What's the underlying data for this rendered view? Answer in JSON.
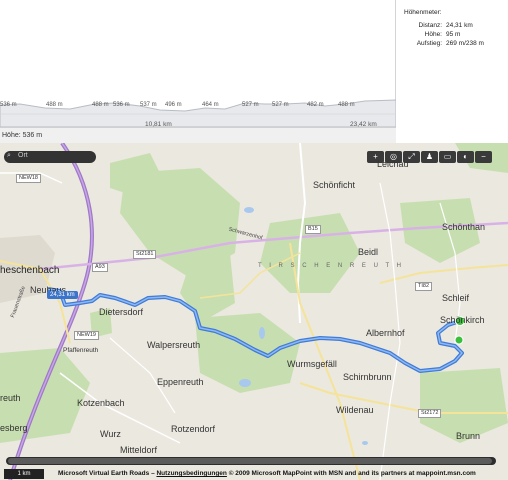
{
  "profile": {
    "tick_labels": [
      "536 m",
      "488 m",
      "488 m",
      "536 m",
      "537 m",
      "496 m",
      "464 m",
      "527 m",
      "527 m",
      "482 m",
      "488 m"
    ],
    "km_marks": [
      "10,81 km",
      "23,42 km"
    ],
    "height_readout": "Höhe: 536 m"
  },
  "stats": {
    "title": "Höhenmeter:",
    "rows": [
      {
        "key": "Distanz:",
        "value": "24,31 km"
      },
      {
        "key": "Höhe:",
        "value": "95 m"
      },
      {
        "key": "Aufstieg:",
        "value": "269 m/238 m"
      }
    ]
  },
  "map": {
    "search_placeholder": "Ort",
    "toolbar": [
      {
        "icon": "zoom-in-icon",
        "glyph": "+"
      },
      {
        "icon": "location-icon",
        "glyph": "◎"
      },
      {
        "icon": "fullscreen-icon",
        "glyph": "⤢"
      },
      {
        "icon": "walk-icon",
        "glyph": "♟"
      },
      {
        "icon": "car-icon",
        "glyph": "▭"
      },
      {
        "icon": "map-layer-icon",
        "glyph": "◐"
      },
      {
        "icon": "zoom-out-icon",
        "glyph": "−"
      }
    ],
    "places": {
      "leichau": "Leichau",
      "schoenficht": "Schönficht",
      "schoenthan": "Schönthan",
      "beidl": "Beidl",
      "schleif": "Schleif",
      "schoenkirch": "Schönkirch",
      "tirschenreuth": "T I R S C H E N R E U T H",
      "eschenbach": "heschenbach",
      "neuhaus": "Neuhaus",
      "dietersdorf": "Dietersdorf",
      "pfaffenreuth": "Pfaffenreuth",
      "walpersreuth": "Walpersreuth",
      "albernhof": "Albernhof",
      "wurmsgefaell": "Wurmsgefäll",
      "schirnbrunn": "Schirnbrunn",
      "eppenreuth": "Eppenreuth",
      "wildenau": "Wildenau",
      "kotzenbach": "Kotzenbach",
      "rotzendorf": "Rotzendorf",
      "wurz": "Wurz",
      "mitteldorf": "Mitteldorf",
      "brunn": "Brunn",
      "hesberg": "esberg",
      "reuth": "reuth"
    },
    "roads": {
      "a93": "A93",
      "st2181": "St2181",
      "b15": "B15",
      "ti82": "TI82",
      "new18": "NEW18",
      "new19": "NEW19",
      "st2172": "St2172"
    },
    "streets": {
      "schwarzenhof": "Schwarzenhof",
      "ringstrasse": "Frauenstraße"
    },
    "distance_label": "24,31 km",
    "scale": "1 km",
    "copyright_pre": "Microsoft Virtual Earth Roads – ",
    "copyright_link": "Nutzungsbedingungen",
    "copyright_post": " © 2009 Microsoft MapPoint with MSN and and its partners at mappoint.msn.com"
  }
}
